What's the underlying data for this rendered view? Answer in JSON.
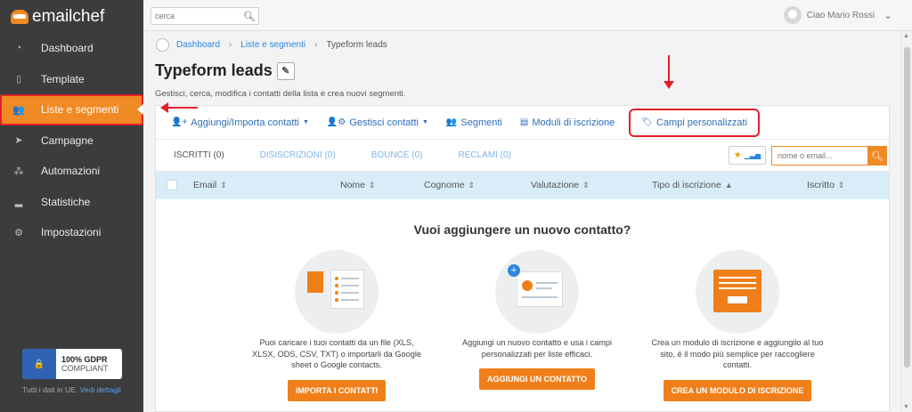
{
  "brand": {
    "name": "emailchef"
  },
  "sidebar": {
    "items": [
      {
        "label": "Dashboard",
        "icon": "dashboard-icon"
      },
      {
        "label": "Template",
        "icon": "template-icon"
      },
      {
        "label": "Liste e segmenti",
        "icon": "users-icon",
        "active": true
      },
      {
        "label": "Campagne",
        "icon": "paper-plane-icon"
      },
      {
        "label": "Automazioni",
        "icon": "automation-icon"
      },
      {
        "label": "Statistiche",
        "icon": "chart-icon"
      },
      {
        "label": "Impostazioni",
        "icon": "gears-icon"
      }
    ],
    "gdpr": {
      "line1": "100% GDPR",
      "line2": "COMPLIANT"
    },
    "eu_note": "Tutti i dati in UE.",
    "eu_link": "Vedi dettagli"
  },
  "topbar": {
    "search_placeholder": "cerca",
    "user_greeting": "Ciao Mario Rossi"
  },
  "breadcrumb": {
    "items": [
      "Dashboard",
      "Liste e segmenti",
      "Typeform leads"
    ]
  },
  "page": {
    "title": "Typeform leads",
    "subtitle": "Gestisci, cerca, modifica i contatti della lista e crea nuovi segmenti."
  },
  "actions": [
    {
      "label": "Aggiungi/Importa contatti",
      "has_caret": true
    },
    {
      "label": "Gestisci contatti",
      "has_caret": true
    },
    {
      "label": "Segmenti",
      "has_caret": false
    },
    {
      "label": "Moduli di iscrizione",
      "has_caret": false
    },
    {
      "label": "Campi personalizzati",
      "has_caret": false,
      "highlighted": true
    }
  ],
  "tabs": [
    {
      "label": "ISCRITTI (0)",
      "active": true
    },
    {
      "label": "DISISCRIZIONI (0)",
      "active": false
    },
    {
      "label": "BOUNCE (0)",
      "active": false
    },
    {
      "label": "RECLAMI (0)",
      "active": false
    }
  ],
  "email_search_placeholder": "nome o email...",
  "table": {
    "columns": [
      "Email",
      "Nome",
      "Cognome",
      "Valutazione",
      "Tipo di iscrizione",
      "Iscritto"
    ]
  },
  "empty": {
    "title": "Vuoi aggiungere un nuovo contatto?",
    "cards": [
      {
        "text": "Puoi caricare i tuoi contatti da un file (XLS, XLSX, ODS, CSV, TXT) o importarli da Google sheet o Google contacts.",
        "button": "IMPORTA I CONTATTI"
      },
      {
        "text": "Aggiungi un nuovo contatto e usa i campi personalizzati per liste efficaci.",
        "button": "AGGIUNGI UN CONTATTO"
      },
      {
        "text": "Crea un modulo di iscrizione e aggiungilo al tuo sito, è il modo più semplice per raccogliere contatti.",
        "button": "CREA UN MODULO DI ISCRIZIONE"
      }
    ]
  },
  "colors": {
    "accent": "#f08a24",
    "link": "#2e6fb8",
    "annotation": "#e3202a"
  }
}
